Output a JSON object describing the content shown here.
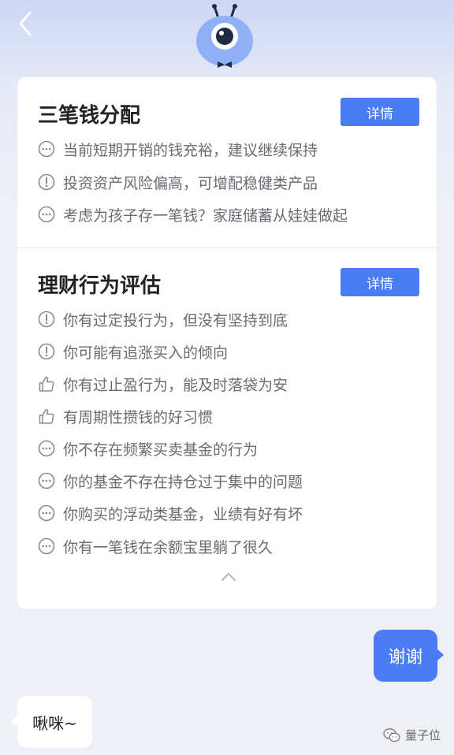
{
  "header": {
    "back_icon": "chevron-left-icon",
    "mascot_icon": "robot-mascot-icon"
  },
  "section1": {
    "title": "三笔钱分配",
    "detail_label": "详情",
    "items": [
      {
        "icon": "more-icon",
        "text": "当前短期开销的钱充裕，建议继续保持"
      },
      {
        "icon": "warning-icon",
        "text": "投资资产风险偏高，可增配稳健类产品"
      },
      {
        "icon": "more-icon",
        "text": "考虑为孩子存一笔钱？家庭储蓄从娃娃做起"
      }
    ]
  },
  "section2": {
    "title": "理财行为评估",
    "detail_label": "详情",
    "items": [
      {
        "icon": "warning-icon",
        "text": "你有过定投行为，但没有坚持到底"
      },
      {
        "icon": "warning-icon",
        "text": "你可能有追涨买入的倾向"
      },
      {
        "icon": "thumbs-up-icon",
        "text": "你有过止盈行为，能及时落袋为安"
      },
      {
        "icon": "thumbs-up-icon",
        "text": "有周期性攒钱的好习惯"
      },
      {
        "icon": "more-icon",
        "text": "你不存在频繁买卖基金的行为"
      },
      {
        "icon": "more-icon",
        "text": "你的基金不存在持仓过于集中的问题"
      },
      {
        "icon": "more-icon",
        "text": "你购买的浮动类基金，业绩有好有坏"
      },
      {
        "icon": "more-icon",
        "text": "你有一笔钱在余额宝里躺了很久"
      }
    ]
  },
  "chat": {
    "user_message": "谢谢",
    "bot_message": "啾咪~"
  },
  "watermark": {
    "text": "量子位",
    "icon": "wechat-icon"
  },
  "colors": {
    "accent": "#4a7cf2",
    "text_secondary": "#6b6b72",
    "title": "#222222"
  }
}
